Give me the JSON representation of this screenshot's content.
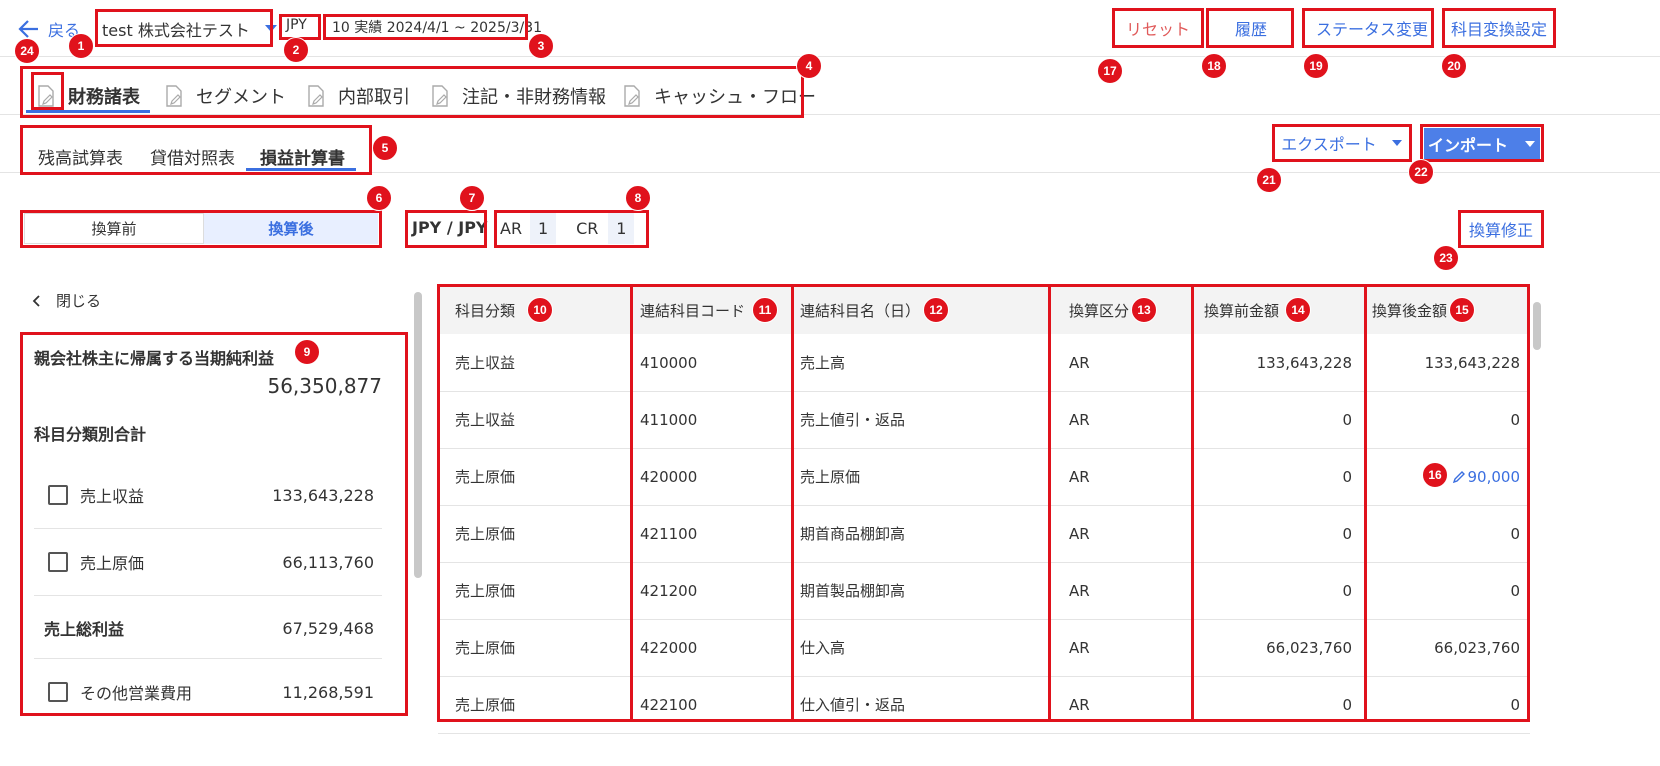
{
  "header": {
    "back_label": "戻る",
    "company": "test 株式会社テスト",
    "currency": "JPY",
    "period": "10 実績 2024/4/1 ~ 2025/3/31",
    "buttons": {
      "reset": "リセット",
      "history": "履歴",
      "status_change": "ステータス変更",
      "account_conversion": "科目変換設定"
    }
  },
  "tabs": [
    "財務諸表",
    "セグメント",
    "内部取引",
    "注記・非財務情報",
    "キャッシュ・フロー"
  ],
  "subtabs": [
    "残高試算表",
    "貸借対照表",
    "損益計算書"
  ],
  "export_label": "エクスポート",
  "import_label": "インポート",
  "toggle": {
    "before": "換算前",
    "after": "換算後"
  },
  "fx": {
    "pair": "JPY / JPY",
    "ar_label": "AR",
    "ar_value": "1",
    "cr_label": "CR",
    "cr_value": "1"
  },
  "conversion_fix": "換算修正",
  "sidebar": {
    "close_label": "閉じる",
    "net_income_label": "親会社株主に帰属する当期純利益",
    "net_income_value": "56,350,877",
    "category_totals_label": "科目分類別合計",
    "rows": [
      {
        "label": "売上収益",
        "value": "133,643,228"
      },
      {
        "label": "売上原価",
        "value": "66,113,760"
      },
      {
        "label": "売上総利益",
        "value": "67,529,468"
      },
      {
        "label": "その他営業費用",
        "value": "11,268,591"
      }
    ]
  },
  "table": {
    "headers": [
      "科目分類",
      "連結科目コード",
      "連結科目名（日）",
      "換算区分",
      "換算前金額",
      "換算後金額"
    ],
    "rows": [
      [
        "売上収益",
        "410000",
        "売上高",
        "AR",
        "133,643,228",
        "133,643,228"
      ],
      [
        "売上収益",
        "411000",
        "売上値引・返品",
        "AR",
        "0",
        "0"
      ],
      [
        "売上原価",
        "420000",
        "売上原価",
        "AR",
        "0",
        "90,000"
      ],
      [
        "売上原価",
        "421100",
        "期首商品棚卸高",
        "AR",
        "0",
        "0"
      ],
      [
        "売上原価",
        "421200",
        "期首製品棚卸高",
        "AR",
        "0",
        "0"
      ],
      [
        "売上原価",
        "422000",
        "仕入高",
        "AR",
        "66,023,760",
        "66,023,760"
      ],
      [
        "売上原価",
        "422100",
        "仕入値引・返品",
        "AR",
        "0",
        "0"
      ]
    ]
  },
  "badges": [
    "1",
    "2",
    "3",
    "4",
    "5",
    "6",
    "7",
    "8",
    "9",
    "10",
    "11",
    "12",
    "13",
    "14",
    "15",
    "16",
    "17",
    "18",
    "19",
    "20",
    "21",
    "22",
    "23",
    "24"
  ],
  "colors": {
    "accent": "#3b6fe0",
    "annotation": "#e0121c",
    "import_bg": "#4d7fe8"
  }
}
